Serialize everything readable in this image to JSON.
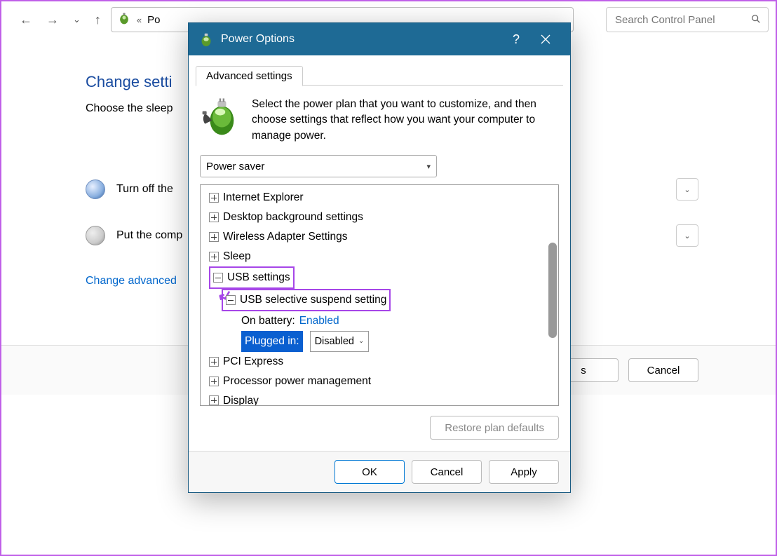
{
  "toolbar": {
    "breadcrumb_prefix": "«",
    "breadcrumb_item": "Po",
    "search_placeholder": "Search Control Panel"
  },
  "cp": {
    "title": "Change setti",
    "subtitle": "Choose the sleep",
    "row1": "Turn off the ",
    "row2": "Put the comp",
    "link": "Change advanced",
    "save": "s",
    "cancel": "Cancel"
  },
  "dialog": {
    "title": "Power Options",
    "tab": "Advanced settings",
    "description": "Select the power plan that you want to customize, and then choose settings that reflect how you want your computer to manage power.",
    "plan": "Power saver",
    "restore": "Restore plan defaults",
    "ok": "OK",
    "cancel": "Cancel",
    "apply": "Apply"
  },
  "tree": {
    "n0": "Internet Explorer",
    "n1": "Desktop background settings",
    "n2": "Wireless Adapter Settings",
    "n3": "Sleep",
    "n4": "USB settings",
    "n4_0": "USB selective suspend setting",
    "n4_0_a_label": "On battery:",
    "n4_0_a_value": "Enabled",
    "n4_0_b_label": "Plugged in:",
    "n4_0_b_value": "Disabled",
    "n5": "PCI Express",
    "n6": "Processor power management",
    "n7": "Display"
  }
}
